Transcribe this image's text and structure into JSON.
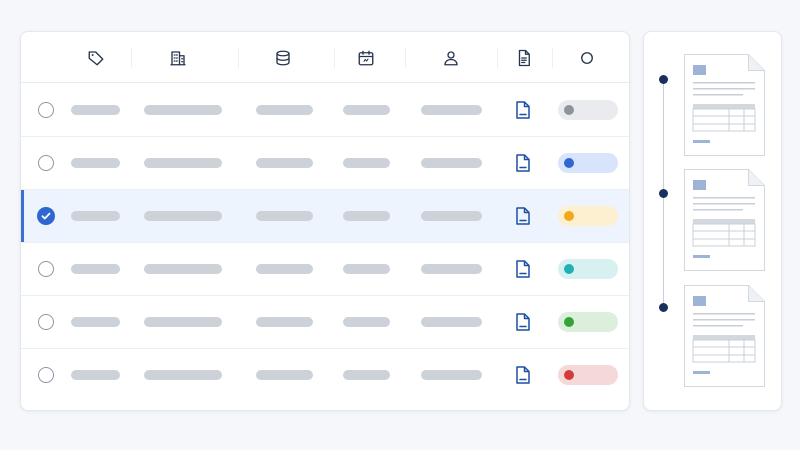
{
  "columns": [
    {
      "icon": "tag-icon"
    },
    {
      "icon": "building-icon"
    },
    {
      "icon": "database-icon"
    },
    {
      "icon": "calendar-icon"
    },
    {
      "icon": "user-icon"
    },
    {
      "icon": "document-icon"
    },
    {
      "icon": "status-circle-icon"
    }
  ],
  "colors": {
    "accent": "#2f66d0",
    "icon_dark": "#26344d",
    "doc_blue": "#1d4fa3",
    "timeline_dot": "#17305c",
    "placeholder_bar": "#cdd1d8"
  },
  "rows": [
    {
      "selected": false,
      "status": {
        "color": "gray",
        "pill": "#e9ebee",
        "dot": "#8f939a"
      }
    },
    {
      "selected": false,
      "status": {
        "color": "blue",
        "pill": "#d7e4fb",
        "dot": "#2f66d0"
      }
    },
    {
      "selected": true,
      "status": {
        "color": "yellow",
        "pill": "#fdf0d1",
        "dot": "#f2a81d"
      }
    },
    {
      "selected": false,
      "status": {
        "color": "teal",
        "pill": "#d8f0f0",
        "dot": "#1fb1b5"
      }
    },
    {
      "selected": false,
      "status": {
        "color": "green",
        "pill": "#dcefdc",
        "dot": "#35a335"
      }
    },
    {
      "selected": false,
      "status": {
        "color": "red",
        "pill": "#f5d9d9",
        "dot": "#d33c3c"
      }
    }
  ],
  "timeline": {
    "items": [
      {
        "icon": "invoice-thumbnail-icon"
      },
      {
        "icon": "invoice-thumbnail-icon"
      },
      {
        "icon": "invoice-thumbnail-icon"
      }
    ]
  }
}
